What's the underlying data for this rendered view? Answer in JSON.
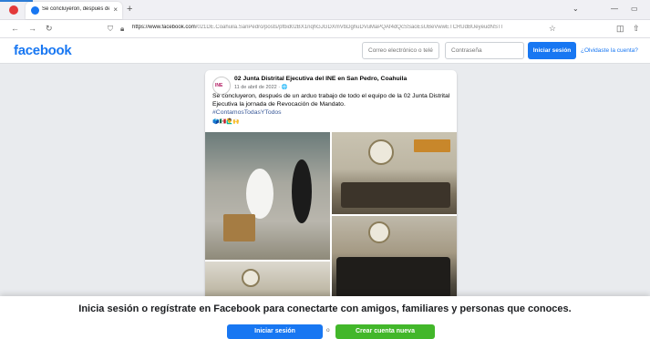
{
  "browser": {
    "tab_title": "Se concluyeron, después de un",
    "tab_close": "×",
    "new_tab": "+",
    "url_host": "https://www.facebook.com",
    "url_path": "/021DE.Coahuila.SanPedro/posts/pfbid02BX1nqhGJGDXmVbDghuDVuMaPQAf4dQcSSaoEsUBeVwwETCRUdBUeyeudNSTl",
    "back": "←",
    "forward": "→",
    "reload": "↻",
    "bookmark": "☆",
    "window_controls": [
      "⌄",
      "—",
      "▭"
    ]
  },
  "header": {
    "logo": "facebook",
    "email_placeholder": "Correo electrónico o teléf",
    "password_placeholder": "Contraseña",
    "login_label": "Iniciar sesión",
    "forgot_label": "¿Olvidaste la cuenta?"
  },
  "post": {
    "avatar_text": "INE",
    "page_name": "02 Junta Distrital Ejecutiva del INE en San Pedro, Coahuila",
    "date": "11 de abril de 2022 · 🌐",
    "text": "Se concluyeron, después de un arduo  trabajo de todo el equipo de la 02 Junta Distrital Ejecutiva la jornada de Revocación de Mandato.",
    "hashtag": "#ContamosTodasYTodos",
    "emojis": "🗳️🇲🇽🙋‍♂️🙌"
  },
  "banner": {
    "text": "Inicia sesión o regístrate en Facebook para conectarte con amigos, familiares y personas que conoces.",
    "login_label": "Iniciar sesión",
    "or_label": "o",
    "create_label": "Crear cuenta nueva"
  },
  "colors": {
    "brand": "#1877f2",
    "create_green": "#42b72a"
  }
}
